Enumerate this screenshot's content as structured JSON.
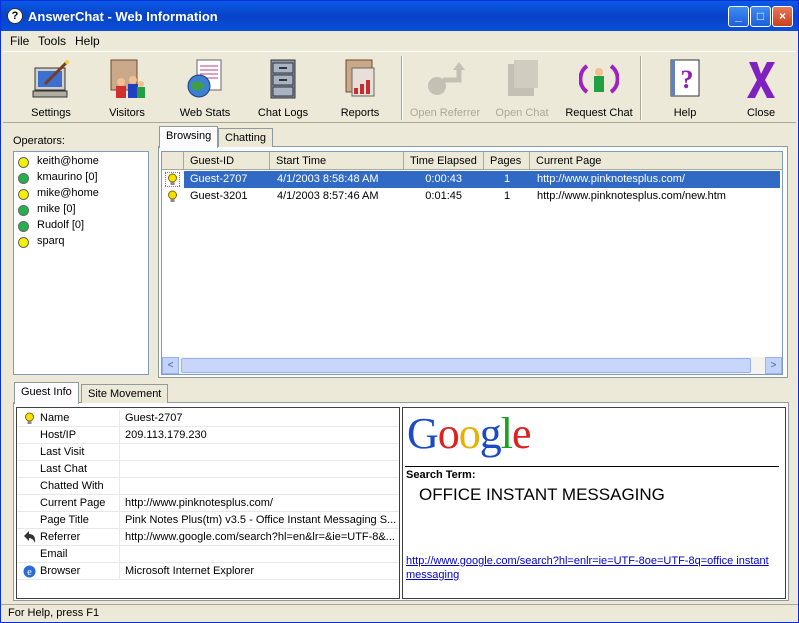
{
  "window": {
    "title": "AnswerChat - Web Information",
    "icon": "question-icon"
  },
  "titlebar_buttons": {
    "minimize": "_",
    "maximize": "□",
    "close": "×"
  },
  "menu": [
    {
      "label": "File"
    },
    {
      "label": "Tools"
    },
    {
      "label": "Help"
    }
  ],
  "toolbar": {
    "settings": "Settings",
    "visitors": "Visitors",
    "web_stats": "Web Stats",
    "chat_logs": "Chat Logs",
    "reports": "Reports",
    "open_referrer": "Open Referrer",
    "open_chat": "Open Chat",
    "request_chat": "Request Chat",
    "help": "Help",
    "close": "Close"
  },
  "operators": {
    "label": "Operators:",
    "items": [
      {
        "name": "keith@home",
        "status_color": "#f5f000"
      },
      {
        "name": "kmaurino [0]",
        "status_color": "#22b14c"
      },
      {
        "name": "mike@home",
        "status_color": "#f5f000"
      },
      {
        "name": "mike [0]",
        "status_color": "#22b14c"
      },
      {
        "name": "Rudolf [0]",
        "status_color": "#22b14c"
      },
      {
        "name": "sparq",
        "status_color": "#f5f000"
      }
    ]
  },
  "top_tabs": [
    "Browsing",
    "Chatting"
  ],
  "grid": {
    "columns": [
      "Guest-ID",
      "Start Time",
      "Time Elapsed",
      "Pages",
      "Current Page"
    ],
    "rows": [
      {
        "guest_id": "Guest-2707",
        "start_time": "4/1/2003 8:58:48 AM",
        "elapsed": "0:00:43",
        "pages": "1",
        "current_page": "http://www.pinknotesplus.com/"
      },
      {
        "guest_id": "Guest-3201",
        "start_time": "4/1/2003 8:57:46 AM",
        "elapsed": "0:01:45",
        "pages": "1",
        "current_page": "http://www.pinknotesplus.com/new.htm"
      }
    ],
    "scroll_left": "<",
    "scroll_right": ">"
  },
  "bottom_tabs": [
    "Guest Info",
    "Site Movement"
  ],
  "guest_info": [
    {
      "key": "Name",
      "value": "Guest-2707",
      "icon": "lightbulb-icon"
    },
    {
      "key": "Host/IP",
      "value": "209.113.179.230"
    },
    {
      "key": "Last Visit",
      "value": ""
    },
    {
      "key": "Last Chat",
      "value": ""
    },
    {
      "key": "Chatted With",
      "value": ""
    },
    {
      "key": "Current Page",
      "value": "http://www.pinknotesplus.com/"
    },
    {
      "key": "Page Title",
      "value": "Pink Notes Plus(tm) v3.5 - Office Instant Messaging S..."
    },
    {
      "key": "Referrer",
      "value": "http://www.google.com/search?hl=en&lr=&ie=UTF-8&...",
      "icon": "back-arrow-icon"
    },
    {
      "key": "Email",
      "value": ""
    },
    {
      "key": "Browser",
      "value": "Microsoft Internet Explorer",
      "icon": "ie-icon"
    }
  ],
  "search_pane": {
    "logo": "Google",
    "search_term_label": "Search Term:",
    "search_term": "OFFICE INSTANT MESSAGING",
    "link": "http://www.google.com/search?hl=enlr=ie=UTF-8oe=UTF-8q=office instant messaging"
  },
  "status": {
    "text": "For Help, press F1"
  }
}
